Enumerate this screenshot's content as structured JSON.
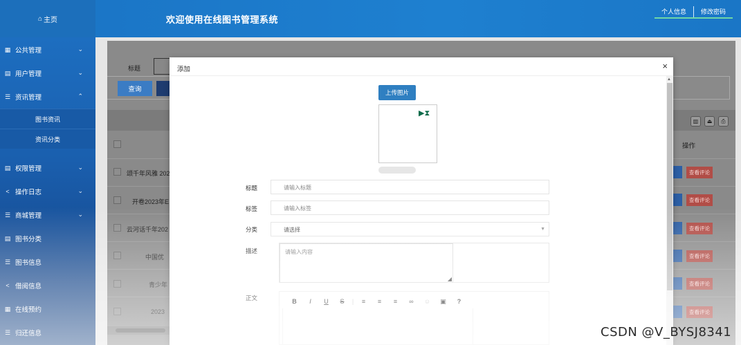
{
  "header": {
    "home_label": "主页",
    "home_icon": "home-icon",
    "system_title": "欢迎使用在线图书管理系统",
    "profile_link": "个人信息",
    "change_password_link": "修改密码"
  },
  "sidebar": {
    "items": [
      {
        "label": "公共管理",
        "icon": "grid-icon",
        "expandable": true
      },
      {
        "label": "用户管理",
        "icon": "book-icon",
        "expandable": true
      },
      {
        "label": "资讯管理",
        "icon": "list-icon",
        "expandable": true,
        "expanded": true
      },
      {
        "label": "权限管理",
        "icon": "book-icon",
        "expandable": true
      },
      {
        "label": "操作日志",
        "icon": "share-icon",
        "expandable": true
      },
      {
        "label": "商城管理",
        "icon": "list-icon",
        "expandable": true
      },
      {
        "label": "图书分类",
        "icon": "book-icon",
        "expandable": false
      },
      {
        "label": "图书信息",
        "icon": "list-icon",
        "expandable": false
      },
      {
        "label": "借阅信息",
        "icon": "share-icon",
        "expandable": false
      },
      {
        "label": "在线预约",
        "icon": "grid-icon",
        "expandable": false
      },
      {
        "label": "归还信息",
        "icon": "list-icon",
        "expandable": false
      }
    ],
    "sub_items": [
      {
        "label": "图书资讯"
      },
      {
        "label": "资讯分类"
      }
    ]
  },
  "list_page": {
    "search_label": "标题",
    "query_button": "查询",
    "operation_column": "操作",
    "review_button": "查看评论",
    "rows": [
      {
        "title": "颂千年风雅 202"
      },
      {
        "title": "开卷2023年E"
      },
      {
        "title": "云河话千年202"
      },
      {
        "title": "中国优"
      },
      {
        "title": "青少年"
      },
      {
        "title": "2023"
      }
    ]
  },
  "modal": {
    "title": "添加",
    "close": "×",
    "upload_button": "上传图片",
    "fields": {
      "title_label": "标题",
      "title_placeholder": "请输入标题",
      "tags_label": "标签",
      "tags_placeholder": "请输入标签",
      "category_label": "分类",
      "category_value": "请选择",
      "desc_label": "描述",
      "desc_placeholder": "请输入内容",
      "body_label": "正文"
    },
    "editor_toolbar": [
      "B",
      "I",
      "U",
      "S",
      "align-left",
      "align-center",
      "align-right",
      "link",
      "emoji",
      "image",
      "?"
    ]
  },
  "watermark": "CSDN @V_BYSJ8341"
}
